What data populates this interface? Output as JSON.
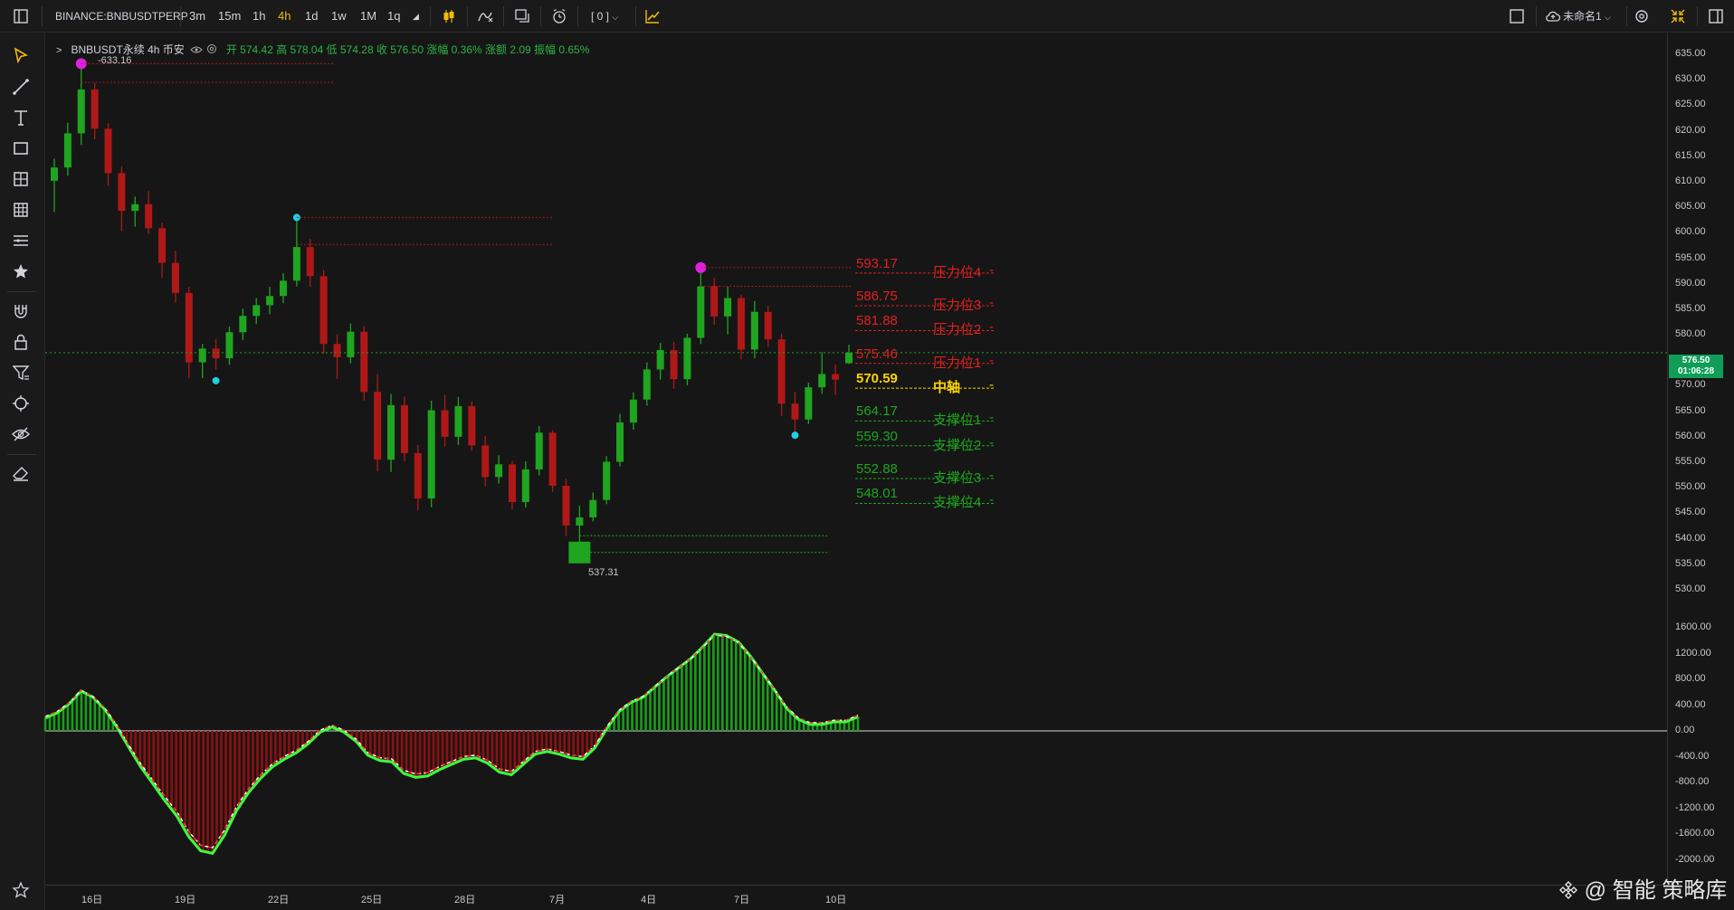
{
  "header": {
    "symbol": "BINANCE:BNBUSDTPERP",
    "intervals": [
      "3m",
      "15m",
      "1h",
      "4h",
      "1d",
      "1w",
      "1M",
      "1q"
    ],
    "active_interval": "4h",
    "indicator_badge": "[ 0 ]",
    "layout_name": "未命名1"
  },
  "legend": {
    "title": "BNBUSDT永续 4h 币安",
    "values": "开 574.42 高 578.04 低 574.28 收 576.50 涨幅 0.36% 涨额 2.09 振幅 0.65%"
  },
  "annotations": {
    "high_label": "633.16",
    "low_label": "537.31"
  },
  "levels": [
    {
      "price": "593.17",
      "name": "压力位4",
      "color": "#e02020"
    },
    {
      "price": "586.75",
      "name": "压力位3",
      "color": "#e02020"
    },
    {
      "price": "581.88",
      "name": "压力位2",
      "color": "#e02020"
    },
    {
      "price": "575.46",
      "name": "压力位1",
      "color": "#e02020"
    },
    {
      "price": "570.59",
      "name": "中轴",
      "color": "#ffd600"
    },
    {
      "price": "564.17",
      "name": "支撑位1",
      "color": "#1fa51f"
    },
    {
      "price": "559.30",
      "name": "支撑位2",
      "color": "#1fa51f"
    },
    {
      "price": "552.88",
      "name": "支撑位3",
      "color": "#1fa51f"
    },
    {
      "price": "548.01",
      "name": "支撑位4",
      "color": "#1fa51f"
    }
  ],
  "price_axis": {
    "labels": [
      "635.00",
      "630.00",
      "625.00",
      "620.00",
      "615.00",
      "610.00",
      "605.00",
      "600.00",
      "595.00",
      "590.00",
      "585.00",
      "580.00",
      "575.00",
      "570.00",
      "565.00",
      "560.00",
      "555.00",
      "550.00",
      "545.00",
      "540.00",
      "535.00",
      "530.00"
    ],
    "current_price": "576.50",
    "countdown": "01:06:28"
  },
  "osc_axis": {
    "labels": [
      "1600.00",
      "1200.00",
      "800.00",
      "400.00",
      "0.00",
      "-400.00",
      "-800.00",
      "-1200.00",
      "-1600.00",
      "-2000.00"
    ]
  },
  "time_axis": {
    "labels": [
      "16日",
      "19日",
      "22日",
      "25日",
      "28日",
      "7月",
      "4日",
      "7日",
      "10日"
    ]
  },
  "watermark": "@ 智能 策略库",
  "colors": {
    "up": "#1fa51f",
    "down": "#b01818",
    "accent": "#f0b90b",
    "marker_top": "#e020e0",
    "marker_bottom": "#20d0e0"
  },
  "chart_data": {
    "type": "candlestick",
    "interval": "4h",
    "y_range": [
      530,
      635
    ],
    "candles": [
      [
        610.2,
        614.5,
        604.1,
        612.8
      ],
      [
        612.8,
        621.6,
        611.2,
        619.5
      ],
      [
        619.5,
        633.16,
        617.2,
        628.1
      ],
      [
        628.1,
        629.4,
        618.3,
        620.4
      ],
      [
        620.4,
        621.5,
        609.2,
        611.7
      ],
      [
        611.7,
        613.0,
        600.4,
        604.3
      ],
      [
        604.3,
        607.1,
        601.2,
        605.6
      ],
      [
        605.6,
        608.2,
        599.8,
        600.9
      ],
      [
        600.9,
        602.0,
        591.2,
        594.1
      ],
      [
        594.1,
        596.5,
        586.3,
        588.2
      ],
      [
        588.2,
        589.4,
        571.5,
        574.6
      ],
      [
        574.6,
        578.2,
        571.5,
        577.3
      ],
      [
        577.3,
        579.1,
        573.2,
        575.4
      ],
      [
        575.4,
        581.6,
        574.1,
        580.5
      ],
      [
        580.5,
        585.1,
        579.0,
        583.7
      ],
      [
        583.7,
        587.2,
        582.1,
        585.8
      ],
      [
        585.8,
        589.4,
        584.0,
        587.6
      ],
      [
        587.6,
        592.1,
        586.2,
        590.6
      ],
      [
        590.6,
        603.0,
        589.5,
        597.2
      ],
      [
        597.2,
        598.8,
        589.4,
        591.5
      ],
      [
        591.5,
        592.7,
        576.3,
        578.2
      ],
      [
        578.2,
        580.1,
        571.4,
        575.6
      ],
      [
        575.6,
        582.2,
        574.4,
        580.6
      ],
      [
        580.6,
        581.7,
        567.1,
        568.8
      ],
      [
        568.8,
        572.3,
        553.2,
        555.5
      ],
      [
        555.5,
        568.4,
        553.1,
        566.2
      ],
      [
        566.2,
        567.9,
        555.2,
        556.8
      ],
      [
        556.8,
        558.4,
        545.6,
        547.9
      ],
      [
        547.9,
        567.1,
        546.2,
        565.2
      ],
      [
        565.2,
        568.2,
        558.1,
        560.0
      ],
      [
        560.0,
        567.8,
        558.4,
        566.0
      ],
      [
        566.0,
        566.9,
        557.2,
        558.3
      ],
      [
        558.3,
        560.2,
        550.3,
        552.1
      ],
      [
        552.1,
        556.4,
        550.8,
        554.6
      ],
      [
        554.6,
        555.3,
        545.8,
        547.2
      ],
      [
        547.2,
        555.2,
        546.1,
        553.6
      ],
      [
        553.6,
        562.1,
        552.4,
        560.8
      ],
      [
        560.8,
        561.3,
        549.2,
        550.4
      ],
      [
        550.4,
        551.8,
        540.5,
        542.6
      ],
      [
        542.6,
        546.5,
        537.31,
        544.2
      ],
      [
        544.2,
        549.1,
        543.4,
        547.6
      ],
      [
        547.6,
        556.2,
        546.8,
        555.1
      ],
      [
        555.1,
        564.5,
        554.2,
        562.8
      ],
      [
        562.8,
        568.7,
        561.4,
        567.3
      ],
      [
        567.3,
        574.6,
        566.1,
        573.2
      ],
      [
        573.2,
        578.4,
        571.2,
        577.0
      ],
      [
        577.0,
        578.6,
        569.4,
        571.3
      ],
      [
        571.3,
        580.2,
        570.1,
        579.4
      ],
      [
        579.4,
        593.17,
        578.2,
        589.5
      ],
      [
        589.5,
        591.2,
        582.0,
        583.6
      ],
      [
        583.6,
        589.4,
        580.1,
        587.2
      ],
      [
        587.2,
        587.9,
        575.2,
        577.1
      ],
      [
        577.1,
        586.6,
        575.4,
        584.5
      ],
      [
        584.5,
        585.7,
        577.6,
        579.1
      ],
      [
        579.1,
        580.2,
        564.1,
        566.5
      ],
      [
        566.5,
        568.8,
        560.8,
        563.4
      ],
      [
        563.4,
        570.6,
        562.5,
        569.7
      ],
      [
        569.7,
        576.6,
        568.4,
        572.3
      ],
      [
        572.3,
        574.2,
        568.2,
        571.2
      ],
      [
        574.42,
        578.04,
        574.28,
        576.5
      ]
    ],
    "oscillator": {
      "zero": 0,
      "y_range": [
        -2000,
        1600
      ],
      "values": [
        200,
        280,
        420,
        620,
        520,
        330,
        60,
        -260,
        -560,
        -820,
        -1080,
        -1320,
        -1640,
        -1860,
        -1900,
        -1620,
        -1240,
        -960,
        -740,
        -560,
        -440,
        -340,
        -200,
        -20,
        60,
        -20,
        -160,
        -380,
        -460,
        -480,
        -660,
        -720,
        -700,
        -600,
        -520,
        -440,
        -420,
        -500,
        -640,
        -680,
        -520,
        -360,
        -320,
        -360,
        -420,
        -440,
        -260,
        40,
        300,
        440,
        520,
        680,
        840,
        980,
        1120,
        1300,
        1500,
        1480,
        1380,
        1160,
        900,
        640,
        360,
        180,
        100,
        100,
        140,
        140,
        220
      ]
    }
  }
}
